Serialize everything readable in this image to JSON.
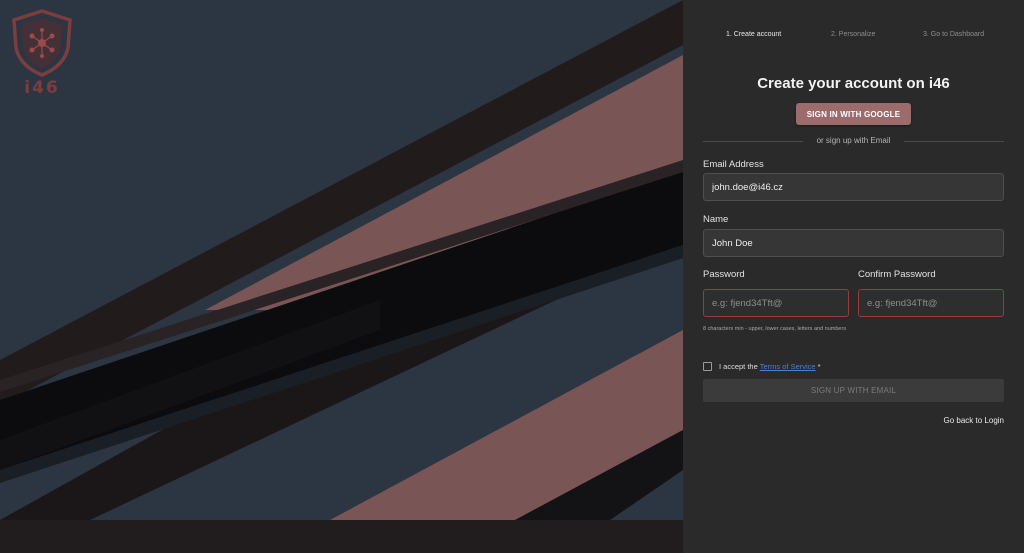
{
  "brand": {
    "logo_text": "i46",
    "logo_icon": "shield-circuit-icon",
    "accent": "#7e3d3d"
  },
  "steps": [
    {
      "label": "1. Create account",
      "active": true
    },
    {
      "label": "2. Personalize",
      "active": false
    },
    {
      "label": "3. Go to Dashboard",
      "active": false
    }
  ],
  "form": {
    "title": "Create your account on i46",
    "google_button": "SIGN IN WITH GOOGLE",
    "divider_text": "or sign up with Email",
    "email": {
      "label": "Email Address",
      "value": "john.doe@i46.cz"
    },
    "name": {
      "label": "Name",
      "value": "John Doe"
    },
    "password": {
      "label": "Password",
      "placeholder": "e.g: fjend34Tft@"
    },
    "confirm_password": {
      "label": "Confirm Password",
      "placeholder": "e.g: fjend34Tft@"
    },
    "password_hint": "8 characters min - upper, lower cases, letters and numbers",
    "terms": {
      "prefix": "I accept the ",
      "link": "Terms of Service",
      "required_mark": " *"
    },
    "signup_button": "SIGN UP WITH EMAIL",
    "back_link": "Go back to Login"
  },
  "colors": {
    "panel_bg": "#2a2a2a",
    "google_button": "#9c6b6c",
    "error_border": "#9b3a3a",
    "link": "#4f7fd1"
  }
}
